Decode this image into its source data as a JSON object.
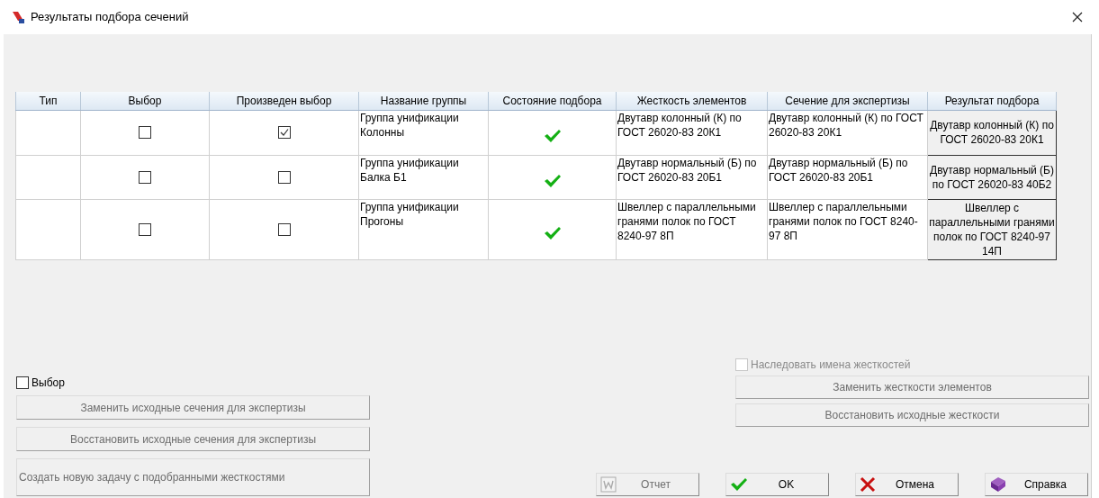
{
  "window": {
    "title": "Результаты подбора сечений"
  },
  "table": {
    "columns": [
      "Тип",
      "Выбор",
      "Произведен выбор",
      "Название группы",
      "Состояние подбора",
      "Жесткость элементов",
      "Сечение для экспертизы",
      "Результат подбора"
    ],
    "rows": [
      {
        "select": false,
        "chosen": true,
        "group": "Группа унификации\nКолонны",
        "status_ok": true,
        "stiffness": "Двутавр колонный (К) по ГОСТ 26020-83  20К1",
        "section": "Двутавр колонный (К) по ГОСТ 26020-83  20К1",
        "result": "Двутавр колонный (К) по ГОСТ 26020-83  20К1"
      },
      {
        "select": false,
        "chosen": false,
        "group": "Группа унификации\nБалка Б1",
        "status_ok": true,
        "stiffness": "Двутавр нормальный (Б) по ГОСТ 26020-83  20Б1",
        "section": "Двутавр нормальный (Б) по ГОСТ 26020-83  20Б1",
        "result": "Двутавр нормальный (Б) по ГОСТ 26020-83 40Б2"
      },
      {
        "select": false,
        "chosen": false,
        "group": "Группа унификации\nПрогоны",
        "status_ok": true,
        "stiffness": "Швеллер с параллельными гранями полок по ГОСТ 8240-97 8П",
        "section": "Швеллер с параллельными гранями полок по ГОСТ 8240-97 8П",
        "result": "Швеллер с параллельными гранями полок по ГОСТ 8240-97 14П"
      }
    ]
  },
  "left_panel": {
    "select_all": {
      "label": "Выбор",
      "checked": false
    },
    "buttons": [
      {
        "label": "Заменить исходные сечения для экспертизы",
        "disabled": true
      },
      {
        "label": "Восстановить исходные сечения для экспертизы",
        "disabled": true
      },
      {
        "label": "Создать новую задачу с подобранными жесткостями",
        "disabled": true
      }
    ]
  },
  "right_panel": {
    "inherit_names": {
      "label": "Наследовать имена жесткостей",
      "checked": false,
      "disabled": true
    },
    "buttons": [
      {
        "label": "Заменить жесткости элементов",
        "disabled": true
      },
      {
        "label": "Восстановить исходные жесткости",
        "disabled": true
      }
    ]
  },
  "footer_buttons": [
    {
      "label": "Отчет",
      "kind": "report",
      "disabled": true
    },
    {
      "label": "OK",
      "kind": "ok",
      "disabled": false
    },
    {
      "label": "Отмена",
      "kind": "cancel",
      "disabled": false
    },
    {
      "label": "Справка",
      "kind": "help",
      "disabled": false
    }
  ]
}
